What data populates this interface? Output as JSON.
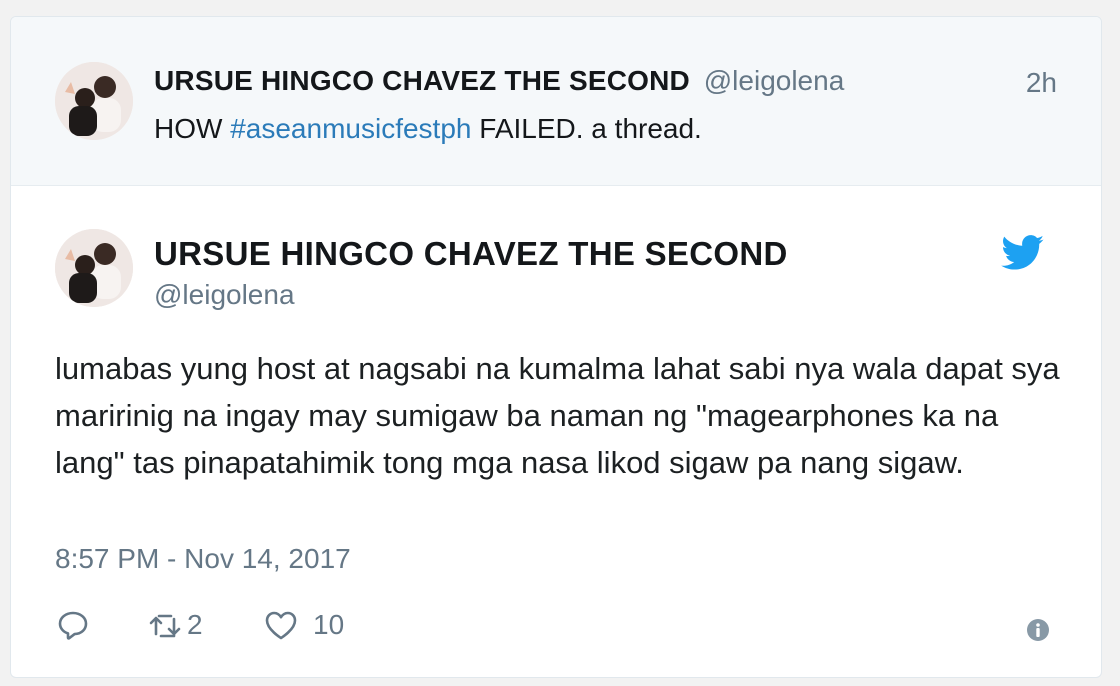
{
  "parent_tweet": {
    "author_name": "URSUE HINGCO CHAVEZ THE SECOND",
    "handle": "@leigolena",
    "timestamp": "2h",
    "text_prefix": "HOW",
    "hashtag": "#aseanmusicfestph",
    "text_suffix": "FAILED. a thread."
  },
  "main_tweet": {
    "author_name": "URSUE HINGCO CHAVEZ THE SECOND",
    "handle": "@leigolena",
    "text": "lumabas yung host at nagsabi na kumalma lahat sabi nya wala dapat sya maririnig na ingay may sumigaw ba naman ng \"magearphones ka na lang\" tas pinapatahimik tong mga nasa likod sigaw pa nang sigaw.",
    "timestamp": "8:57 PM - Nov 14, 2017",
    "retweet_count": "2",
    "like_count": "10"
  },
  "icons": {
    "reply": "reply-icon",
    "retweet": "retweet-icon",
    "like": "heart-icon",
    "info": "info-icon",
    "brand": "twitter-bird-icon"
  },
  "colors": {
    "brand_blue": "#1da1f2",
    "hashtag_blue": "#2b7bb9",
    "muted_gray": "#657786",
    "parent_bg": "#f5f8fa"
  }
}
